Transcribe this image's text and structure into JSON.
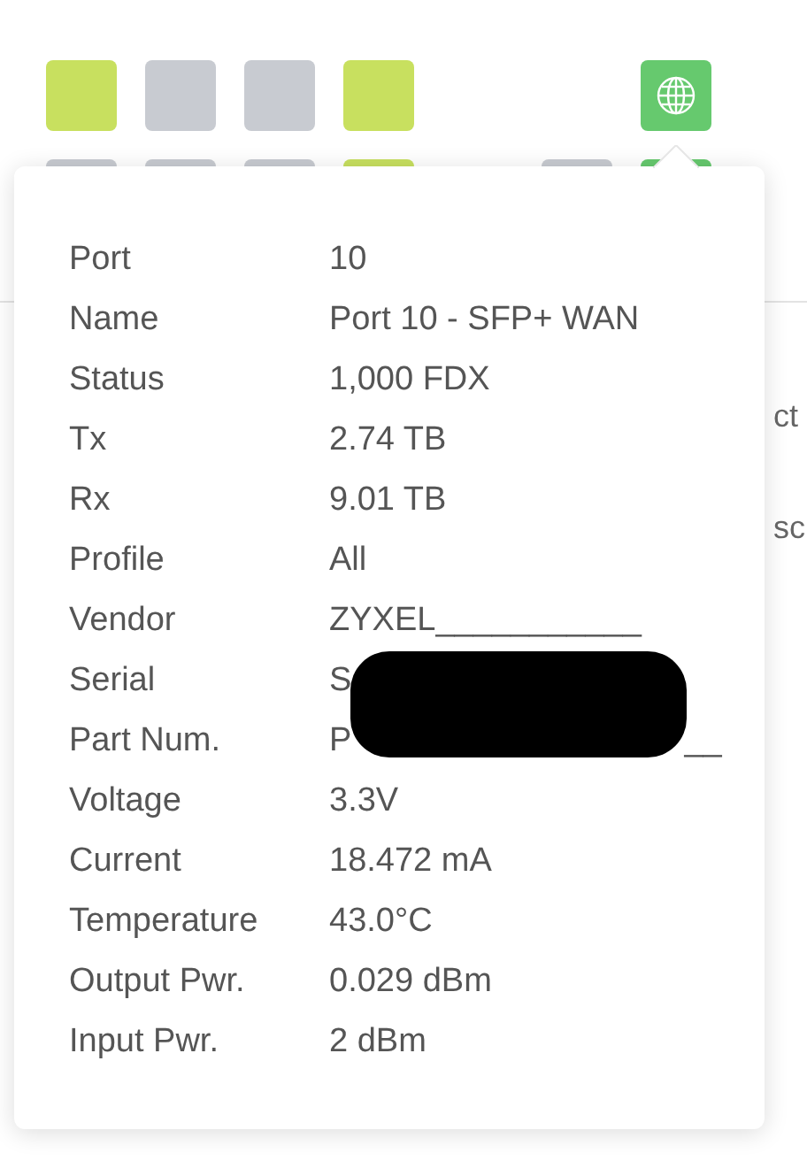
{
  "ports_top": [
    {
      "kind": "tile",
      "color": "#c8e05f"
    },
    {
      "kind": "tile",
      "color": "#c8cbd1"
    },
    {
      "kind": "tile",
      "color": "#c8cbd1"
    },
    {
      "kind": "tile",
      "color": "#c8e05f"
    },
    {
      "kind": "gap"
    },
    {
      "kind": "gap"
    },
    {
      "kind": "globe",
      "color": "#66c96e"
    }
  ],
  "ports_bottom": [
    {
      "kind": "tile",
      "color": "#c8cbd1"
    },
    {
      "kind": "tile",
      "color": "#c8cbd1"
    },
    {
      "kind": "tile",
      "color": "#c8cbd1"
    },
    {
      "kind": "tile",
      "color": "#c8e05f"
    },
    {
      "kind": "gap"
    },
    {
      "kind": "tile",
      "color": "#c8cbd1"
    },
    {
      "kind": "tile",
      "color": "#66c96e"
    }
  ],
  "background_texts": [
    "ct",
    "sc"
  ],
  "popover": {
    "rows": [
      {
        "label": "Port",
        "value": "10"
      },
      {
        "label": "Name",
        "value": "Port 10 - SFP+ WAN"
      },
      {
        "label": "Status",
        "value": "1,000 FDX"
      },
      {
        "label": "Tx",
        "value": "2.74 TB"
      },
      {
        "label": "Rx",
        "value": "9.01 TB"
      },
      {
        "label": "Profile",
        "value": "All"
      },
      {
        "label": "Vendor",
        "value": "ZYXEL___________"
      },
      {
        "label": "Serial",
        "value": "S"
      },
      {
        "label": "Part Num.",
        "value": "P",
        "tail": "__"
      },
      {
        "label": "Voltage",
        "value": "3.3V"
      },
      {
        "label": "Current",
        "value": "18.472 mA"
      },
      {
        "label": "Temperature",
        "value": "43.0°C"
      },
      {
        "label": "Output Pwr.",
        "value": "0.029 dBm"
      },
      {
        "label": "Input Pwr.",
        "value": "2 dBm"
      }
    ]
  }
}
